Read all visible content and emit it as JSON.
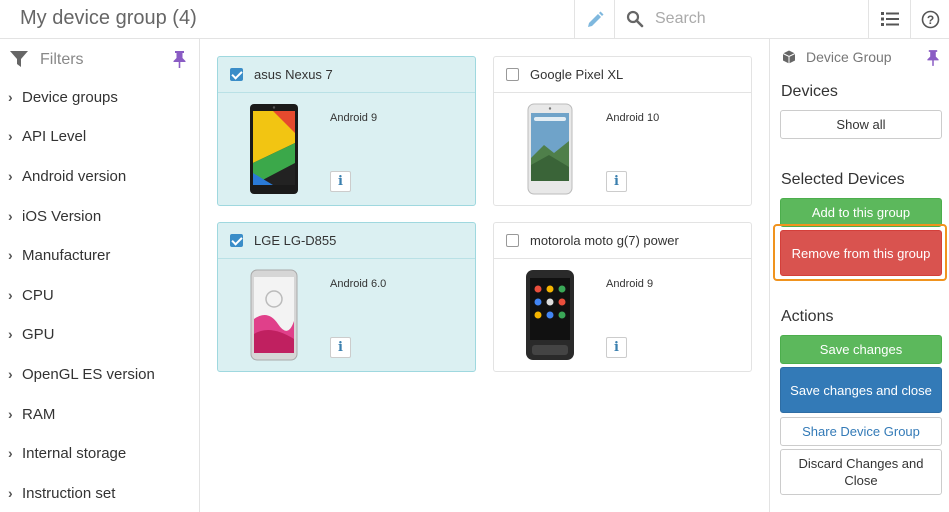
{
  "header": {
    "title": "My device group (4)",
    "search_placeholder": "Search"
  },
  "sidebar": {
    "filters_label": "Filters",
    "items": [
      {
        "label": "Device groups"
      },
      {
        "label": "API Level"
      },
      {
        "label": "Android version"
      },
      {
        "label": "iOS Version"
      },
      {
        "label": "Manufacturer"
      },
      {
        "label": "CPU"
      },
      {
        "label": "GPU"
      },
      {
        "label": "OpenGL ES version"
      },
      {
        "label": "RAM"
      },
      {
        "label": "Internal storage"
      },
      {
        "label": "Instruction set"
      }
    ]
  },
  "devices": [
    {
      "name": "asus Nexus 7",
      "os": "Android 9",
      "selected": true
    },
    {
      "name": "Google Pixel XL",
      "os": "Android 10",
      "selected": false
    },
    {
      "name": "LGE LG-D855",
      "os": "Android 6.0",
      "selected": true
    },
    {
      "name": "motorola moto g(7) power",
      "os": "Android 9",
      "selected": false
    }
  ],
  "right_panel": {
    "title": "Device Group",
    "devices_heading": "Devices",
    "show_all": "Show all",
    "selected_heading": "Selected Devices",
    "add_to_group": "Add to this group",
    "remove_from_group": "Remove from this group",
    "actions_heading": "Actions",
    "save_changes": "Save changes",
    "save_and_close": "Save changes and close",
    "share_group": "Share Device Group",
    "discard_and_close": "Discard Changes and Close"
  },
  "colors": {
    "accent_blue": "#3a8dc8",
    "selected_card_bg": "#dbf0f2",
    "green_button": "#5cb85c",
    "red_button": "#d9534f",
    "blue_button": "#337ab7",
    "highlight_outline": "#f0931e"
  },
  "icons": {
    "header": [
      "pencil-icon",
      "search-icon",
      "list-view-icon",
      "help-icon"
    ],
    "sidebar": [
      "funnel-icon",
      "pin-icon",
      "chevron-right-icon"
    ],
    "panel": [
      "cube-icon",
      "pin-icon"
    ],
    "card": [
      "info-icon"
    ]
  }
}
